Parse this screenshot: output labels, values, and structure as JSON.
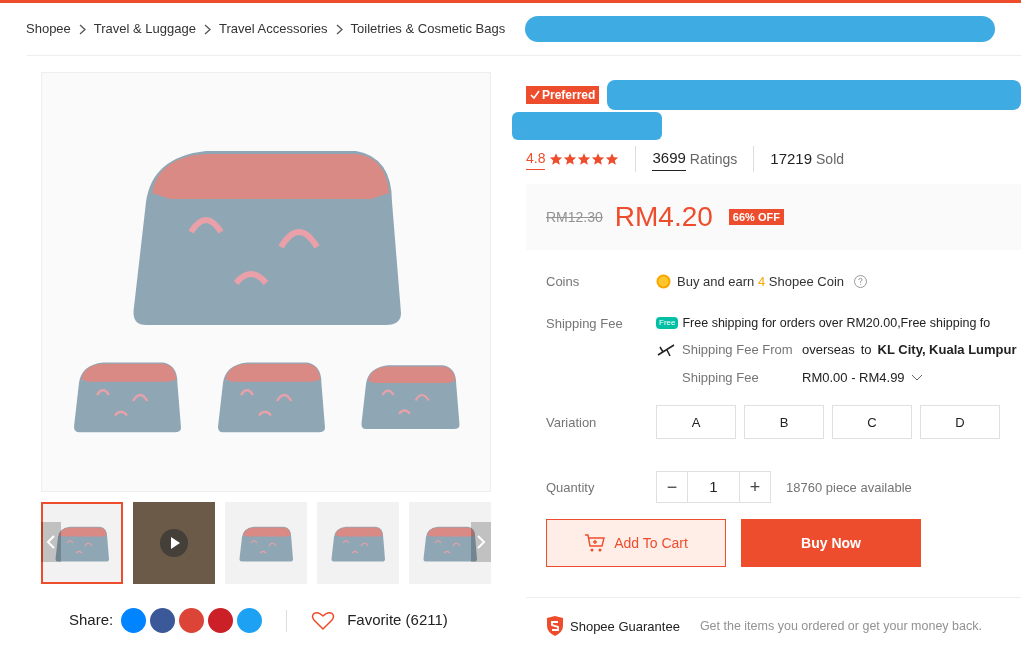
{
  "breadcrumb": [
    "Shopee",
    "Travel & Luggage",
    "Travel Accessories",
    "Toiletries & Cosmetic Bags"
  ],
  "gallery": {
    "thumbnails": [
      {
        "kind": "photo",
        "selected": true
      },
      {
        "kind": "video",
        "selected": false
      },
      {
        "kind": "photo",
        "selected": false
      },
      {
        "kind": "photo",
        "selected": false
      },
      {
        "kind": "photo",
        "selected": false
      }
    ]
  },
  "share": {
    "label": "Share:"
  },
  "favorite": "Favorite (6211)",
  "product": {
    "badge": "Preferred",
    "rating": "4.8",
    "stars": 5,
    "ratings_count": "3699",
    "ratings_label": "Ratings",
    "sold_count": "17219",
    "sold_label": "Sold",
    "original_price": "RM12.30",
    "price": "RM4.20",
    "discount": "66% OFF"
  },
  "coins": {
    "label": "Coins",
    "text_before": "Buy and earn",
    "amount": "4",
    "text_after": "Shopee Coin"
  },
  "shipping": {
    "label": "Shipping Fee",
    "free_badge": "Free",
    "free_text": "Free shipping for orders over RM20.00,Free shipping fo",
    "from_label": "Shipping Fee From",
    "from_value": "overseas",
    "to_label": "to",
    "destination": "KL City, Kuala Lumpur",
    "fee_label": "Shipping Fee",
    "fee_value": "RM0.00 - RM4.99"
  },
  "variation": {
    "label": "Variation",
    "options": [
      {
        "label": "A",
        "selected": false
      },
      {
        "label": "B",
        "selected": false
      },
      {
        "label": "C",
        "selected": false
      },
      {
        "label": "D",
        "selected": false
      }
    ]
  },
  "quantity": {
    "label": "Quantity",
    "minus": "−",
    "value": "1",
    "plus": "+",
    "available": "18760 piece available"
  },
  "buttons": {
    "add_to_cart": "Add To Cart",
    "buy_now": "Buy Now"
  },
  "guarantee": {
    "title": "Shopee Guarantee",
    "text": "Get the items you ordered or get your money back."
  }
}
